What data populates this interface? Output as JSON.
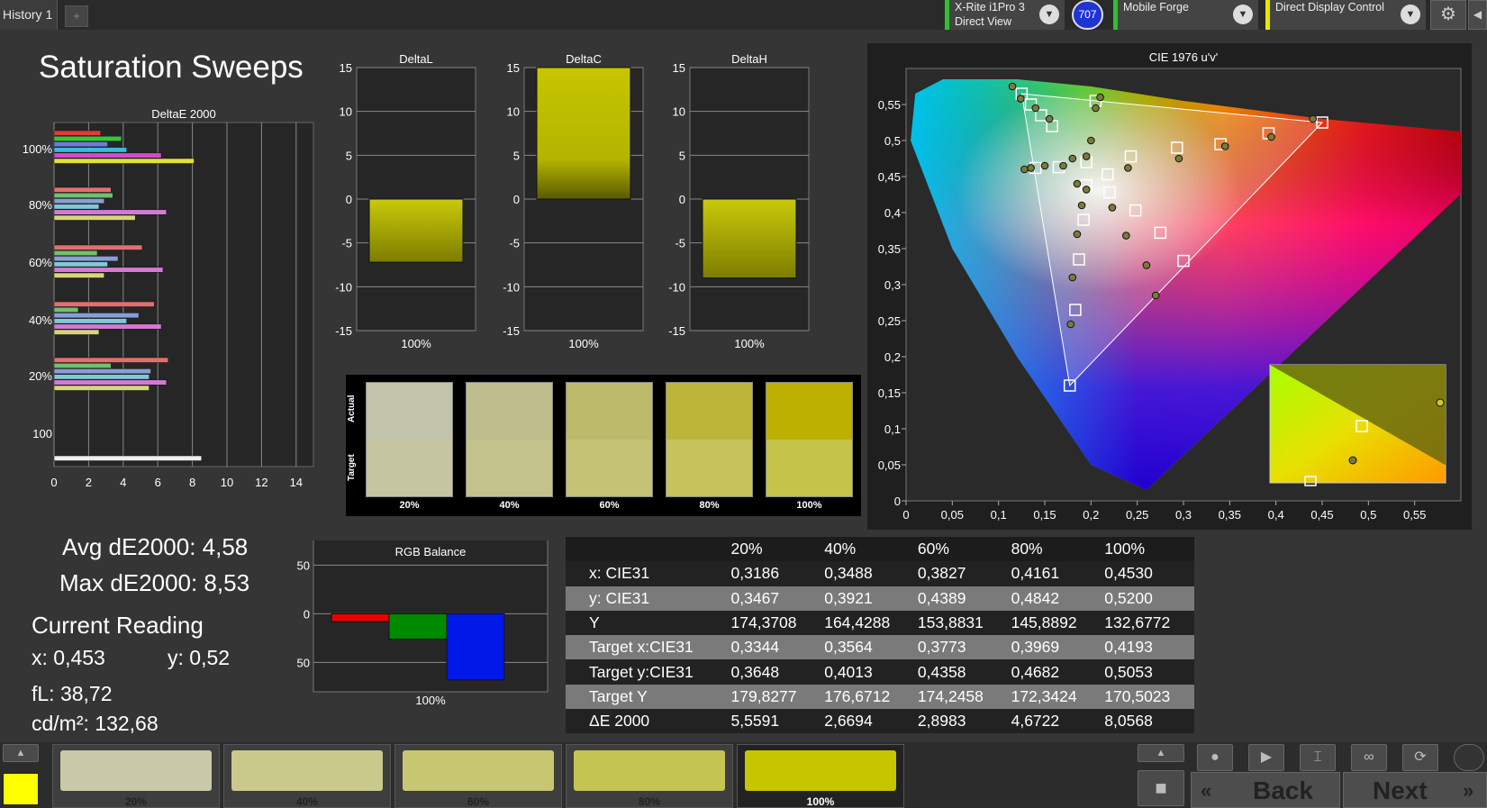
{
  "topbar": {
    "history_tab": "History 1",
    "add_tab": "+",
    "probe": {
      "line1": "X-Rite i1Pro 3",
      "line2": "Direct View"
    },
    "probe_badge": "707",
    "workflow": {
      "line1": "Mobile Forge"
    },
    "display_control": {
      "line1": "Direct Display Control"
    },
    "colors": {
      "probe": "#2fbf2f",
      "workflow": "#2fbf2f",
      "display": "#e8e800"
    }
  },
  "page_title": "Saturation Sweeps",
  "stats": {
    "avg": "Avg dE2000: 4,58",
    "max": "Max dE2000: 8,53",
    "current_heading": "Current Reading",
    "x": "x: 0,453",
    "y": "y: 0,52",
    "fl": "fL: 38,72",
    "cdm": "cd/m²: 132,68"
  },
  "deltae_chart": {
    "title": "DeltaE 2000",
    "xticks": [
      "0",
      "2",
      "4",
      "6",
      "8",
      "10",
      "12",
      "14"
    ],
    "xmax": 15,
    "groups": [
      {
        "label": "100%",
        "values": [
          2.7,
          3.9,
          3.1,
          4.2,
          6.2,
          8.1
        ]
      },
      {
        "label": "80%",
        "values": [
          3.3,
          3.4,
          2.9,
          2.6,
          6.5,
          4.7
        ]
      },
      {
        "label": "60%",
        "values": [
          5.1,
          2.5,
          3.7,
          3.1,
          6.3,
          2.9
        ]
      },
      {
        "label": "40%",
        "values": [
          5.8,
          1.4,
          4.9,
          4.2,
          6.2,
          2.6
        ]
      },
      {
        "label": "20%",
        "values": [
          6.6,
          3.3,
          5.6,
          5.5,
          6.5,
          5.5
        ]
      },
      {
        "label": "100",
        "values": [
          8.53
        ]
      }
    ],
    "series_colors": [
      "#e03a3a",
      "#3ac43a",
      "#6a7ed6",
      "#3fb9d6",
      "#d24ad2",
      "#e0e03a"
    ]
  },
  "delta_charts": [
    {
      "title": "DeltaL",
      "value": -7.2,
      "xlabel": "100%"
    },
    {
      "title": "DeltaC",
      "value": 15.0,
      "xlabel": "100%"
    },
    {
      "title": "DeltaH",
      "value": -9.0,
      "xlabel": "100%"
    }
  ],
  "delta_yticks": [
    "15",
    "10",
    "5",
    "0",
    "-5",
    "-10",
    "-15"
  ],
  "swatches": {
    "actual_label": "Actual",
    "target_label": "Target",
    "items": [
      {
        "label": "20%",
        "actual": "#c1c4ab",
        "target": "#c6c5a2"
      },
      {
        "label": "40%",
        "actual": "#bdbd8d",
        "target": "#c3c28c"
      },
      {
        "label": "60%",
        "actual": "#bcb96a",
        "target": "#c4c274"
      },
      {
        "label": "80%",
        "actual": "#bcb53a",
        "target": "#c5c35a"
      },
      {
        "label": "100%",
        "actual": "#bdb000",
        "target": "#c4c44a"
      }
    ]
  },
  "cie_chart": {
    "title": "CIE 1976 u'v'",
    "xticks": [
      "0",
      "0,05",
      "0,1",
      "0,15",
      "0,2",
      "0,25",
      "0,3",
      "0,35",
      "0,4",
      "0,45",
      "0,5",
      "0,55"
    ],
    "yticks": [
      "0",
      "0,05",
      "0,1",
      "0,15",
      "0,2",
      "0,25",
      "0,3",
      "0,35",
      "0,4",
      "0,45",
      "0,5",
      "0,55"
    ],
    "targets": [
      [
        0.125,
        0.565
      ],
      [
        0.135,
        0.55
      ],
      [
        0.146,
        0.535
      ],
      [
        0.158,
        0.52
      ],
      [
        0.205,
        0.555
      ],
      [
        0.195,
        0.47
      ],
      [
        0.165,
        0.463
      ],
      [
        0.14,
        0.462
      ],
      [
        0.195,
        0.438
      ],
      [
        0.218,
        0.453
      ],
      [
        0.243,
        0.478
      ],
      [
        0.293,
        0.49
      ],
      [
        0.34,
        0.495
      ],
      [
        0.392,
        0.51
      ],
      [
        0.45,
        0.525
      ],
      [
        0.22,
        0.428
      ],
      [
        0.248,
        0.403
      ],
      [
        0.275,
        0.372
      ],
      [
        0.3,
        0.333
      ],
      [
        0.192,
        0.39
      ],
      [
        0.187,
        0.335
      ],
      [
        0.183,
        0.265
      ],
      [
        0.177,
        0.16
      ]
    ],
    "measured": [
      [
        0.115,
        0.575
      ],
      [
        0.124,
        0.558
      ],
      [
        0.14,
        0.545
      ],
      [
        0.155,
        0.53
      ],
      [
        0.21,
        0.56
      ],
      [
        0.205,
        0.545
      ],
      [
        0.2,
        0.5
      ],
      [
        0.195,
        0.478
      ],
      [
        0.18,
        0.475
      ],
      [
        0.17,
        0.465
      ],
      [
        0.15,
        0.465
      ],
      [
        0.128,
        0.46
      ],
      [
        0.135,
        0.462
      ],
      [
        0.185,
        0.44
      ],
      [
        0.195,
        0.432
      ],
      [
        0.24,
        0.462
      ],
      [
        0.295,
        0.475
      ],
      [
        0.345,
        0.492
      ],
      [
        0.395,
        0.505
      ],
      [
        0.44,
        0.53
      ],
      [
        0.19,
        0.41
      ],
      [
        0.223,
        0.407
      ],
      [
        0.185,
        0.37
      ],
      [
        0.238,
        0.368
      ],
      [
        0.26,
        0.327
      ],
      [
        0.18,
        0.31
      ],
      [
        0.27,
        0.285
      ],
      [
        0.178,
        0.245
      ]
    ]
  },
  "rgb_balance": {
    "title": "RGB Balance",
    "xlabel": "100%",
    "yticks": [
      "50",
      "0",
      "-50"
    ],
    "bars": [
      {
        "color": "#e80000",
        "value": -8
      },
      {
        "color": "#008a00",
        "value": -26
      },
      {
        "color": "#0018e8",
        "value": -68
      }
    ]
  },
  "table": {
    "headers": [
      "",
      "20%",
      "40%",
      "60%",
      "80%",
      "100%"
    ],
    "rows": [
      [
        "x: CIE31",
        "0,3186",
        "0,3488",
        "0,3827",
        "0,4161",
        "0,4530"
      ],
      [
        "y: CIE31",
        "0,3467",
        "0,3921",
        "0,4389",
        "0,4842",
        "0,5200"
      ],
      [
        "Y",
        "174,3708",
        "164,4288",
        "153,8831",
        "145,8892",
        "132,6772"
      ],
      [
        "Target x:CIE31",
        "0,3344",
        "0,3564",
        "0,3773",
        "0,3969",
        "0,4193"
      ],
      [
        "Target y:CIE31",
        "0,3648",
        "0,4013",
        "0,4358",
        "0,4682",
        "0,5053"
      ],
      [
        "Target Y",
        "179,8277",
        "176,6712",
        "174,2458",
        "172,3424",
        "170,5023"
      ],
      [
        "ΔE 2000",
        "5,5591",
        "2,6694",
        "2,8983",
        "4,6722",
        "8,0568"
      ]
    ]
  },
  "bottom": {
    "current_color": "#ffff00",
    "patches": [
      {
        "label": "20%",
        "color": "#c9c9a8"
      },
      {
        "label": "40%",
        "color": "#c9c98c"
      },
      {
        "label": "60%",
        "color": "#c8c771"
      },
      {
        "label": "80%",
        "color": "#c4c452"
      },
      {
        "label": "100%",
        "color": "#c7c400"
      }
    ],
    "back": "Back",
    "next": "Next"
  }
}
